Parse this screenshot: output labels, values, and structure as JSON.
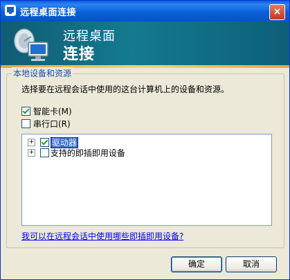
{
  "window": {
    "title": "远程桌面连接",
    "close_glyph": "×"
  },
  "banner": {
    "line1": "远程桌面",
    "line2": "连接",
    "icon": "monitor-satellite-icon"
  },
  "group": {
    "legend": "本地设备和资源",
    "instruction": "选择要在远程会话中使用的这台计算机上的设备和资源。",
    "options": [
      {
        "label": "智能卡(M)",
        "checked": true
      },
      {
        "label": "串行口(R)",
        "checked": false
      }
    ],
    "tree": [
      {
        "label": "驱动器",
        "checked": true,
        "expander": "+",
        "selected": true
      },
      {
        "label": "支持的即插即用设备",
        "checked": false,
        "expander": "+",
        "selected": false
      }
    ],
    "help_link": "我可以在远程会话中使用哪些即插即用设备?"
  },
  "buttons": {
    "ok": "确定",
    "cancel": "取消"
  }
}
